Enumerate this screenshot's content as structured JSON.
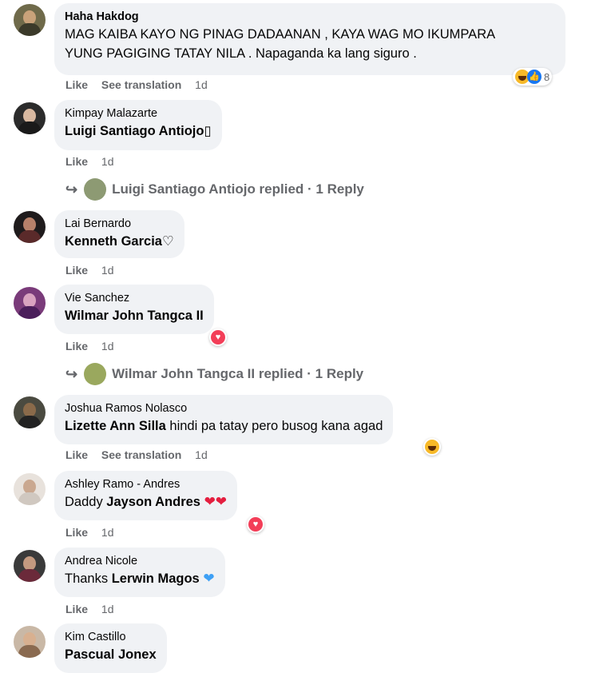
{
  "comments": [
    {
      "author": "Haha Hakdog",
      "line1": "MAG KAIBA KAYO NG PINAG DADAANAN , KAYA WAG MO IKUMPARA",
      "line2": "YUNG PAGIGING TATAY NILA . Napaganda ka lang siguro .",
      "like": "Like",
      "translate": "See translation",
      "time": "1d",
      "reaction_count": "8"
    },
    {
      "author": "Kimpay Malazarte",
      "tag": "Luigi Santiago Antiojo",
      "suffix": "▯",
      "like": "Like",
      "time": "1d",
      "reply": "Luigi Santiago Antiojo replied · 1 Reply"
    },
    {
      "author": "Lai Bernardo",
      "tag": "Kenneth Garcia",
      "suffix": "♡",
      "like": "Like",
      "time": "1d"
    },
    {
      "author": "Vie Sanchez",
      "tag": "Wilmar John Tangca II",
      "like": "Like",
      "time": "1d",
      "reply": "Wilmar John Tangca II replied · 1 Reply"
    },
    {
      "author": "Joshua Ramos Nolasco",
      "tag": "Lizette Ann Silla",
      "rest": " hindi pa tatay pero busog kana agad",
      "like": "Like",
      "translate": "See translation",
      "time": "1d"
    },
    {
      "author": "Ashley Ramo - Andres",
      "prefix": "Daddy ",
      "tag": "Jayson Andres",
      "like": "Like",
      "time": "1d"
    },
    {
      "author": "Andrea Nicole",
      "prefix": "Thanks ",
      "tag": "Lerwin Magos",
      "like": "Like",
      "time": "1d"
    },
    {
      "author": "Kim Castillo",
      "tag": "Pascual Jonex"
    }
  ],
  "icons": {
    "reply_arrow": "reply-arrow-icon",
    "heart": "red-heart-emoji",
    "blue_heart": "blue-heart-emoji"
  },
  "colors": {
    "bubble": "#f0f2f5",
    "meta": "#65676b",
    "like_blue": "#1877f2",
    "love_red": "#f33e58",
    "haha_yellow": "#f7b928"
  }
}
